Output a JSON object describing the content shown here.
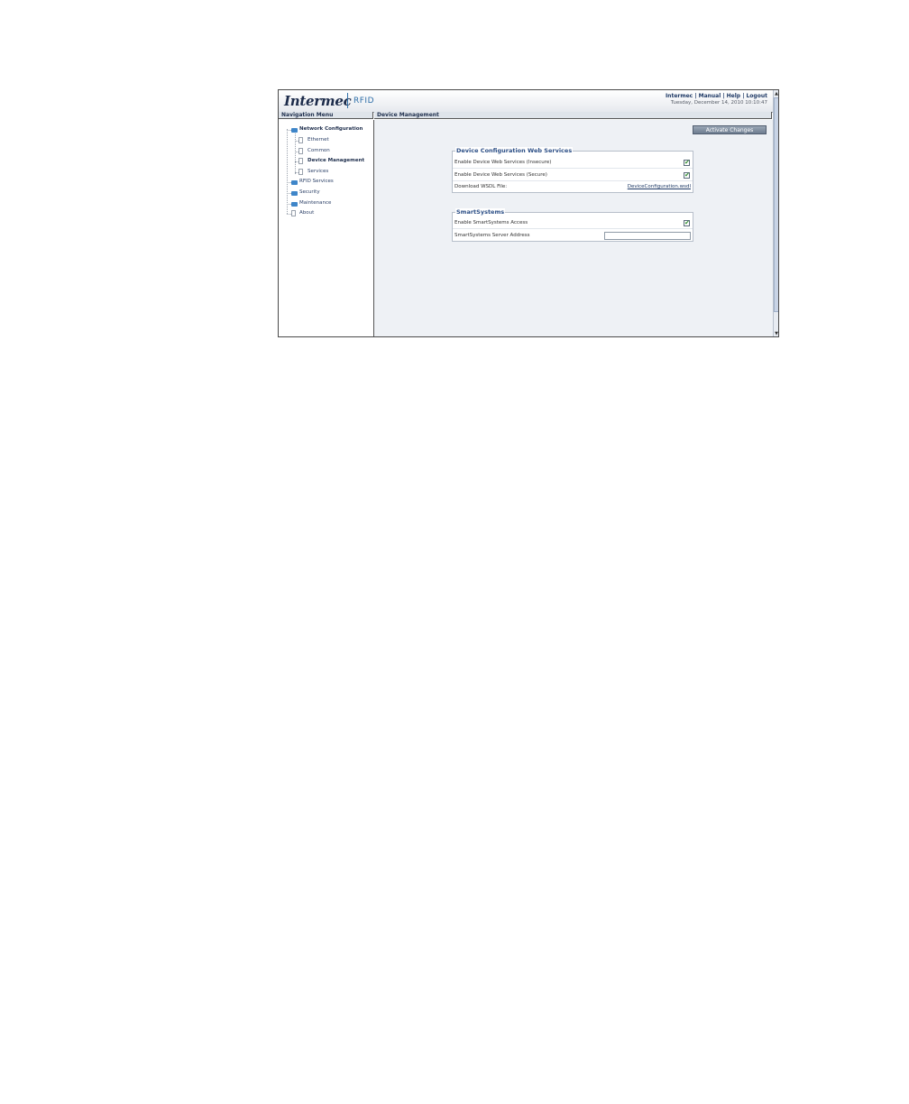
{
  "header": {
    "logo_text": "Intermec",
    "logo_sub": "RFID",
    "links": [
      "Intermec",
      "Manual",
      "Help",
      "Logout"
    ],
    "link_separator": " | ",
    "datetime": "Tuesday, December 14, 2010 10:10:47"
  },
  "nav_title": "Navigation Menu",
  "main_title": "Device Management",
  "nav": {
    "items": [
      {
        "label": "Network Configuration",
        "icon": "folder-icon"
      },
      {
        "label": "Ethernet",
        "icon": "page-icon"
      },
      {
        "label": "Common",
        "icon": "page-icon"
      },
      {
        "label": "Device Management",
        "icon": "page-icon"
      },
      {
        "label": "Services",
        "icon": "page-icon"
      },
      {
        "label": "RFID Services",
        "icon": "folder-icon"
      },
      {
        "label": "Security",
        "icon": "folder-icon"
      },
      {
        "label": "Maintenance",
        "icon": "folder-icon"
      },
      {
        "label": "About",
        "icon": "page-icon"
      }
    ]
  },
  "activate_button": "Activate Changes",
  "device_config": {
    "legend": "Device Configuration Web Services",
    "rows": [
      {
        "label": "Enable Device Web Services (Insecure)",
        "checked": true
      },
      {
        "label": "Enable Device Web Services (Secure)",
        "checked": true
      },
      {
        "label": "Download WSDL File:",
        "link": "DeviceConfiguration.wsdl"
      }
    ]
  },
  "smart_systems": {
    "legend": "SmartSystems",
    "rows": [
      {
        "label": "Enable SmartSystems Access",
        "checked": true
      },
      {
        "label": "SmartSystems Server Address",
        "value": ""
      }
    ]
  },
  "colors": {
    "accent": "#2c4f86",
    "folder": "#3f86c9",
    "check": "#2e8b2e"
  }
}
